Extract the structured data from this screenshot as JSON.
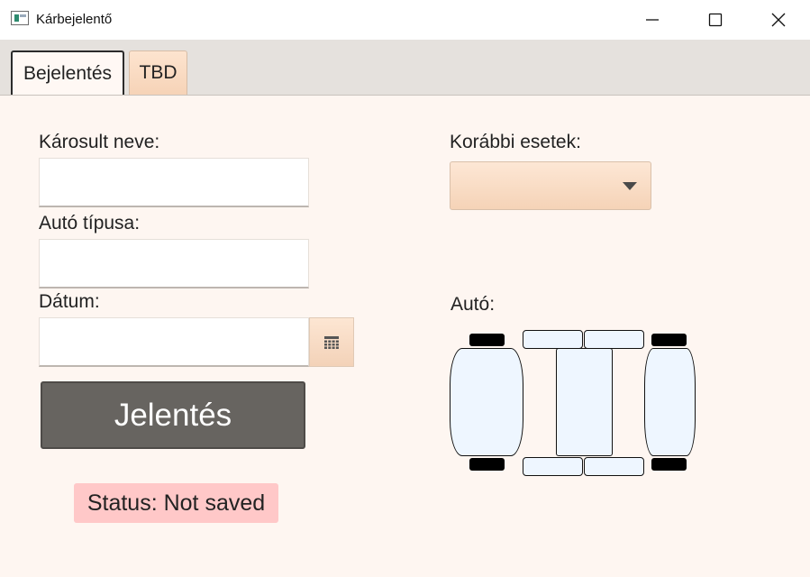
{
  "window": {
    "title": "Kárbejelentő",
    "icon": "app-window-icon",
    "controls": [
      "minimize-icon",
      "maximize-icon",
      "close-icon"
    ]
  },
  "tabs": [
    {
      "label": "Bejelentés",
      "selected": true
    },
    {
      "label": "TBD",
      "selected": false
    }
  ],
  "form": {
    "name_label": "Károsult neve:",
    "name_value": "",
    "car_type_label": "Autó típusa:",
    "car_type_value": "",
    "date_label": "Dátum:",
    "date_value": "",
    "date_picker_icon": "calendar-icon",
    "submit_label": "Jelentés",
    "status_text": "Status: Not saved"
  },
  "previous_cases": {
    "label": "Korábbi esetek:",
    "selected_value": ""
  },
  "car_diagram": {
    "label": "Autó:",
    "parts": [
      "front",
      "hood",
      "rear",
      "front-left-door",
      "front-right-door",
      "rear-left-door",
      "rear-right-door",
      "front-left-tire",
      "front-right-tire",
      "rear-left-tire",
      "rear-right-tire"
    ]
  },
  "colors": {
    "background": "#fef6f1",
    "status_background": "#ffc8c8",
    "button_background": "#676460",
    "accent_gradient": "#f5d3b7"
  }
}
